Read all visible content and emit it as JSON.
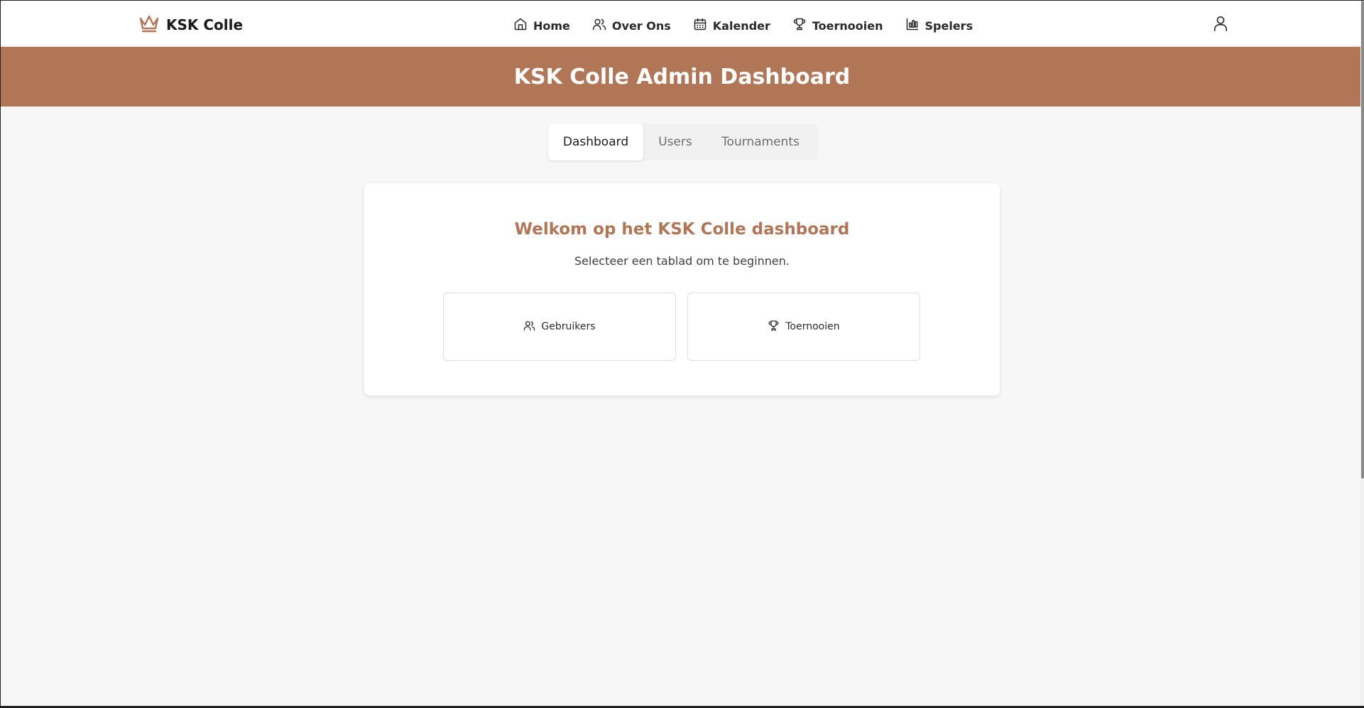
{
  "brand": {
    "name": "KSK Colle",
    "icon": "crown-icon"
  },
  "nav": {
    "items": [
      {
        "label": "Home",
        "icon": "home-icon"
      },
      {
        "label": "Over Ons",
        "icon": "users-icon"
      },
      {
        "label": "Kalender",
        "icon": "calendar-icon"
      },
      {
        "label": "Toernooien",
        "icon": "trophy-icon"
      },
      {
        "label": "Spelers",
        "icon": "bar-chart-icon"
      }
    ],
    "user_icon": "user-icon"
  },
  "banner": {
    "title": "KSK Colle Admin Dashboard"
  },
  "tabs": {
    "items": [
      {
        "label": "Dashboard",
        "active": true
      },
      {
        "label": "Users",
        "active": false
      },
      {
        "label": "Tournaments",
        "active": false
      }
    ]
  },
  "welcome": {
    "title": "Welkom op het KSK Colle dashboard",
    "subtitle": "Selecteer een tablad om te beginnen.",
    "cards": [
      {
        "label": "Gebruikers",
        "icon": "users-icon"
      },
      {
        "label": "Toernooien",
        "icon": "trophy-icon"
      }
    ]
  },
  "colors": {
    "accent": "#b07656",
    "background": "#f7f7f7",
    "surface": "#ffffff"
  }
}
